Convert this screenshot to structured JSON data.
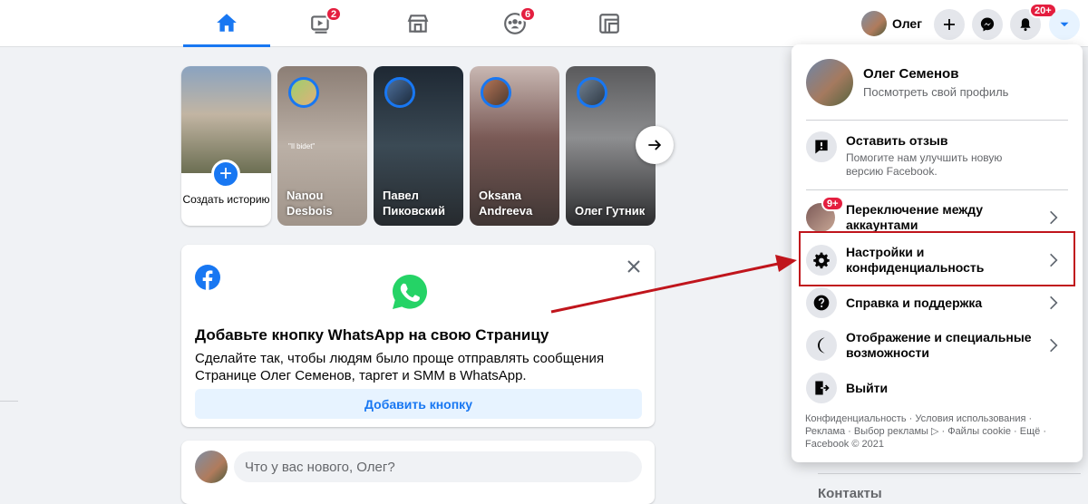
{
  "nav": {
    "tabs": [
      {
        "name": "home",
        "badge": ""
      },
      {
        "name": "watch",
        "badge": "2"
      },
      {
        "name": "marketplace",
        "badge": ""
      },
      {
        "name": "groups",
        "badge": "6"
      },
      {
        "name": "gaming",
        "badge": ""
      }
    ],
    "profile_name": "Олег",
    "notifications_badge": "20+",
    "accent": "#1877f2",
    "badge_color": "#e41e3f"
  },
  "stories": {
    "create_label": "Создать историю",
    "items": [
      {
        "name": "Nanou Desbois"
      },
      {
        "name": "Павел Пиковский"
      },
      {
        "name": "Oksana Andreeva"
      },
      {
        "name": "Олег Гутник"
      }
    ],
    "story_text_overlay": "\"Il bidet\""
  },
  "whatsapp_card": {
    "title": "Добавьте кнопку WhatsApp на свою Страницу",
    "description": "Сделайте так, чтобы людям было проще отправлять сообщения Странице Олег Семенов, таргет и SMM в WhatsApp.",
    "button_label": "Добавить кнопку"
  },
  "composer": {
    "placeholder": "Что у вас нового, Олег?"
  },
  "dropdown": {
    "profile_name": "Олег Семенов",
    "profile_sub": "Посмотреть свой профиль",
    "feedback_title": "Оставить отзыв",
    "feedback_hint": "Помогите нам улучшить новую версию Facebook.",
    "switch_accounts": "Переключение между аккаунтами",
    "switch_badge": "9+",
    "settings": "Настройки и конфиденциальность",
    "help": "Справка и поддержка",
    "display": "Отображение и специальные возможности",
    "logout": "Выйти",
    "footer": "Конфиденциальность · Условия использования · Реклама · Выбор рекламы ▷ · Файлы cookie · Ещё · Facebook © 2021"
  },
  "contacts_label": "Контакты",
  "annotation_color": "#c0151c"
}
